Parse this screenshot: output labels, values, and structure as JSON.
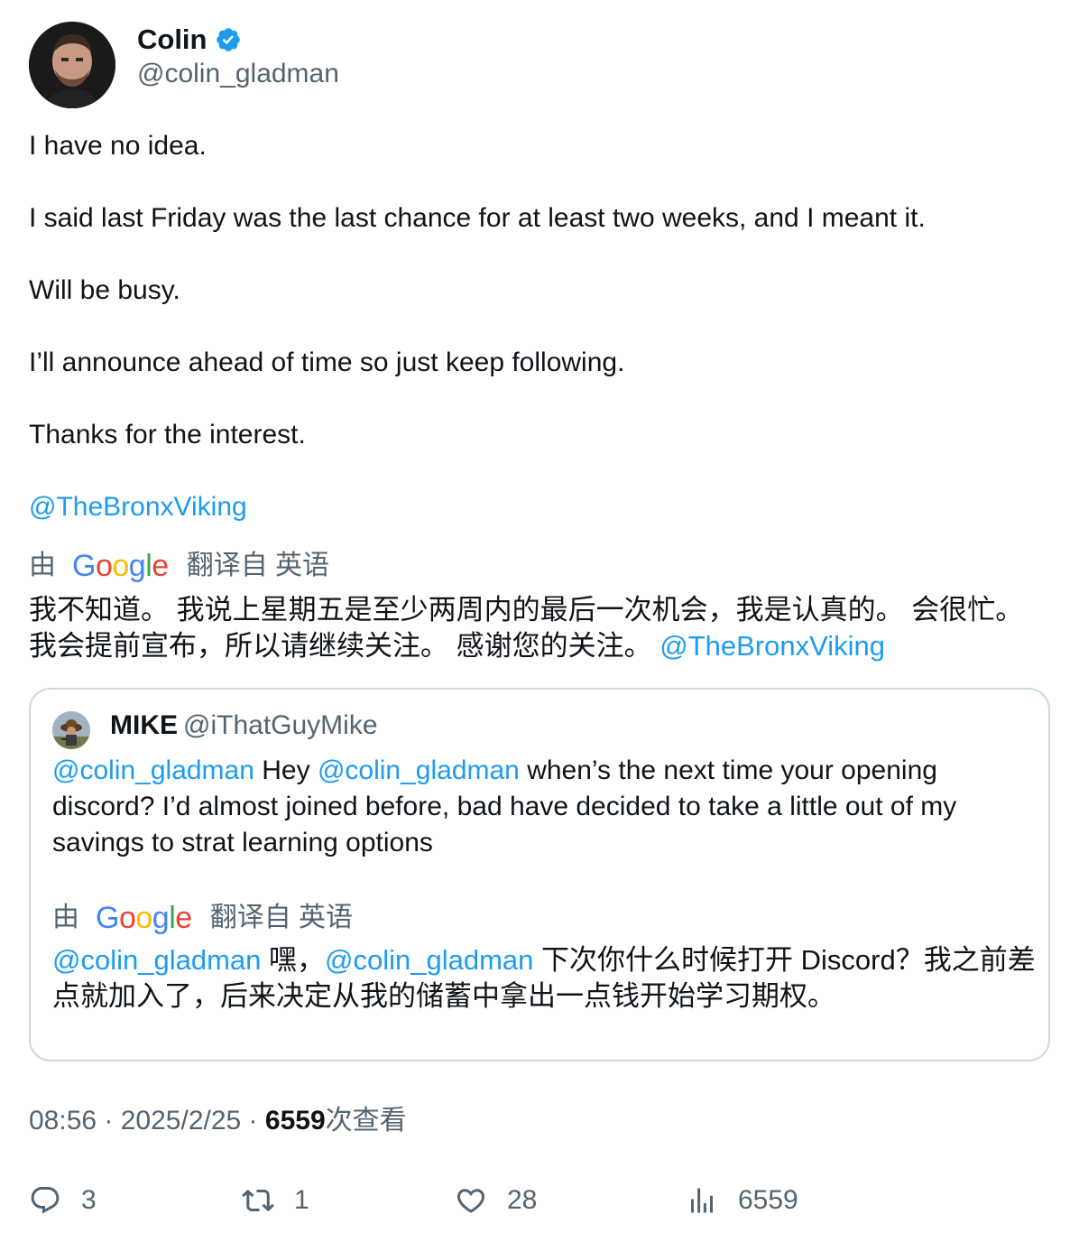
{
  "author": {
    "name": "Colin",
    "handle": "@colin_gladman",
    "verified": true,
    "verified_color": "#1d9bf0"
  },
  "tweet": {
    "lines": [
      "I have no idea.",
      "I said last Friday was the last chance for at least two weeks, and I meant it.",
      "Will be busy.",
      "I’ll announce ahead of time so just keep following.",
      "Thanks for the interest."
    ],
    "mention": "@TheBronxViking"
  },
  "translation": {
    "by": "由",
    "provider": "Google",
    "from_label": "翻译自 英语",
    "text": "我不知道。 我说上星期五是至少两周内的最后一次机会，我是认真的。 会很忙。 我会提前宣布，所以请继续关注。 感谢您的关注。 ",
    "mention": "@TheBronxViking"
  },
  "quote": {
    "name": "MIKE",
    "handle": "@iThatGuyMike",
    "mention_1": "@colin_gladman",
    "text_1": " Hey ",
    "mention_2": "@colin_gladman",
    "text_2": " when’s the next time your opening discord?  I’d almost joined before, bad have decided to take a little out of my savings to strat learning options",
    "translation": {
      "by": "由",
      "provider": "Google",
      "from_label": "翻译自 英语",
      "mention_1": "@colin_gladman",
      "text_1": " 嘿，",
      "mention_2": "@colin_gladman",
      "text_2": " 下次你什么时候打开 Discord？我之前差点就加入了，后来决定从我的储蓄中拿出一点钱开始学习期权。"
    }
  },
  "meta": {
    "time": "08:56",
    "separator": " · ",
    "date": "2025/2/25",
    "views_count": "6559",
    "views_label": "次查看"
  },
  "actions": {
    "replies": "3",
    "retweets": "1",
    "likes": "28",
    "views": "6559"
  },
  "colors": {
    "link": "#1d9bf0",
    "text": "#0f1419",
    "secondary": "#536471",
    "border": "#cfd9de"
  }
}
